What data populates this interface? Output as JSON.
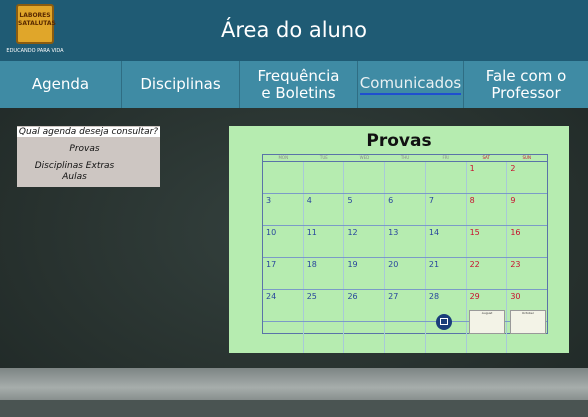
{
  "header": {
    "title": "Área do aluno",
    "logo_text": "LABORES SATALUTAS",
    "logo_tagline": "EDUCANDO PARA VIDA"
  },
  "nav": [
    {
      "label": "Agenda"
    },
    {
      "label": "Disciplinas"
    },
    {
      "label": "Frequência\ne Boletins"
    },
    {
      "label": "Comunicados"
    },
    {
      "label": "Fale com o\nProfessor"
    }
  ],
  "menu": {
    "question": "Qual agenda deseja consultar?",
    "options": [
      "Provas",
      "Disciplinas Extras",
      "Aulas"
    ]
  },
  "calendar": {
    "title": "Provas",
    "weekdays": [
      "MON",
      "TUE",
      "WED",
      "THU",
      "FRI",
      "SAT",
      "SUN"
    ],
    "weeks": [
      [
        "",
        "",
        "",
        "",
        "",
        "1",
        "2"
      ],
      [
        "3",
        "4",
        "5",
        "6",
        "7",
        "8",
        "9"
      ],
      [
        "10",
        "11",
        "12",
        "13",
        "14",
        "15",
        "16"
      ],
      [
        "17",
        "18",
        "19",
        "20",
        "21",
        "22",
        "23"
      ],
      [
        "24",
        "25",
        "26",
        "27",
        "28",
        "29",
        "30"
      ],
      [
        "",
        "",
        "",
        "",
        "",
        "",
        ""
      ]
    ],
    "mini_months": [
      "August",
      "October"
    ]
  },
  "colors": {
    "header": "#1f5b74",
    "nav": "#3f8ba4",
    "calendar_bg": "#b6ecb0",
    "weekend": "#c8102e"
  }
}
